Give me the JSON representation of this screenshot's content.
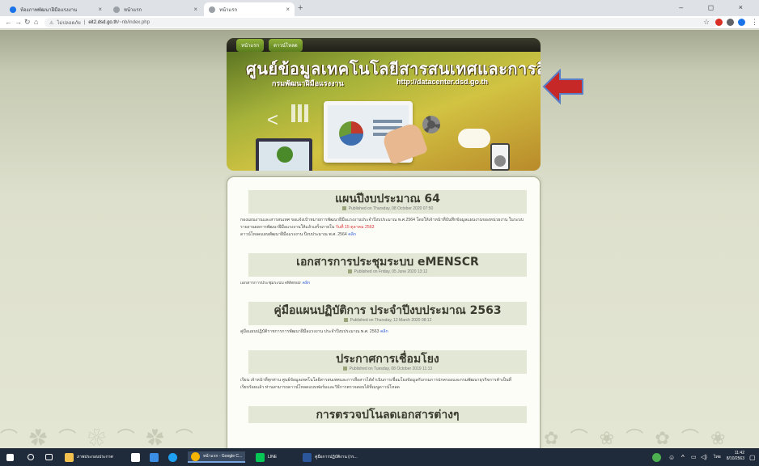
{
  "browser": {
    "tabs": [
      {
        "label": "ห้องภาพพัฒนาฝีมือแรงงาน",
        "color": "#1a73e8",
        "active": false
      },
      {
        "label": "หน้าแรก",
        "color": "#5f6368",
        "active": false
      },
      {
        "label": "หน้าแรก",
        "color": "#5f6368",
        "active": true
      }
    ],
    "new_tab_icon": "plus-icon",
    "window_controls": "– ◻ ×",
    "security_label": "ไม่ปลอดภัย",
    "url_host": "eit2.dsd.go.th",
    "url_path": "/~nb/index.php"
  },
  "site": {
    "menu": [
      "หน้าแรก",
      "ดาวน์โหลด"
    ],
    "title": "ศูนย์ข้อมูลเทคโนโลยีสารสนเทศและการสื่อสาร",
    "subtitle": "กรมพัฒนาฝีมือแรงงาน",
    "url": "http://datacenter.dsd.go.th",
    "accent_color": "#c0392b"
  },
  "articles": [
    {
      "title": "แผนปีงบประมาณ 64",
      "meta": "Published on Thursday, 08 October 2020 07:50",
      "body": "กองแผนงานและสารสนเทศ ขอแจ้งเป้าหมายการพัฒนาฝีมือแรงงานประจำปีงบประมาณ พ.ศ.2564 โดยให้เจ้าหน้าที่บันทึกข้อมูลแผนงานของหน่วยงาน ในระบบรายงานผลการพัฒนาฝีมือแรงงานให้แล้วเสร็จภายใน",
      "highlight": "วันที่ 15 ตุลาคม 2563",
      "line2": "ดาวน์โหลดแผนพัฒนาฝีมือแรงงาน ปีงบประมาณ พ.ศ. 2564",
      "link": "คลิก"
    },
    {
      "title": "เอกสารการประชุมระบบ eMENSCR",
      "meta": "Published on Friday, 05 June 2020 13:12",
      "body": "เอกสารการประชุมระบบ eMenscr",
      "highlight": "",
      "line2": "",
      "link": "คลิก"
    },
    {
      "title": "คู่มือแผนปฏิบัติการ ประจำปีงบประมาณ 2563",
      "meta": "Published on Thursday, 12 March 2020 08:12",
      "body": "คู่มือแผนปฏิบัติราชการการพัฒนาฝีมือแรงงาน ประจำปีงบประมาณ พ.ศ. 2563",
      "highlight": "",
      "line2": "",
      "link": "คลิก"
    },
    {
      "title": "ประกาศการเชื่อมโยง",
      "meta": "Published on Tuesday, 08 October 2019 11:13",
      "body": "เรียน เจ้าหน้าที่ทุกท่าน ศูนย์ข้อมูลเทคโนโลยีสารสนเทศและการสื่อสารได้ดำเนินการเชื่อมโยงข้อมูลกับกรมการปกครองและกรมพัฒนาธุรกิจการค้าเป็นที่เรียบร้อยแล้ว ท่านสามารถดาวน์โหลดแบบฟอร์มและวิธีการตรวจสอบได้ที่เมนูดาวน์โหลด",
      "highlight": "",
      "line2": "",
      "link": ""
    },
    {
      "title": "การตรวจปโนลดเอกสารต่างๆ",
      "meta": "",
      "body": "",
      "highlight": "",
      "line2": "",
      "link": ""
    }
  ],
  "taskbar": {
    "items": [
      {
        "label": "",
        "icon": "windows-start-icon",
        "color": "#ffffff"
      },
      {
        "label": "",
        "icon": "search-icon",
        "color": "#ffffff"
      },
      {
        "label": "",
        "icon": "task-view-icon",
        "color": "#ffffff"
      },
      {
        "label": "ภาพประกอบประกาศ",
        "icon": "folder-icon",
        "color": "#f2c14e"
      },
      {
        "label": "",
        "icon": "store-icon",
        "color": "#ffffff"
      },
      {
        "label": "",
        "icon": "mail-icon",
        "color": "#3a8ee6"
      },
      {
        "label": "",
        "icon": "edge-icon",
        "color": "#1ea1f2"
      },
      {
        "label": "หน้าแรก - Google C...",
        "icon": "chrome-icon",
        "color": "#f4b400",
        "active": true
      },
      {
        "label": "LINE",
        "icon": "line-icon",
        "color": "#06c755"
      },
      {
        "label": "คู่มือการปฏิบัติงาน (กร...",
        "icon": "word-icon",
        "color": "#2b579a"
      }
    ],
    "clock_time": "11:42",
    "clock_date": "8/10/2563",
    "lang": "ไทย"
  }
}
